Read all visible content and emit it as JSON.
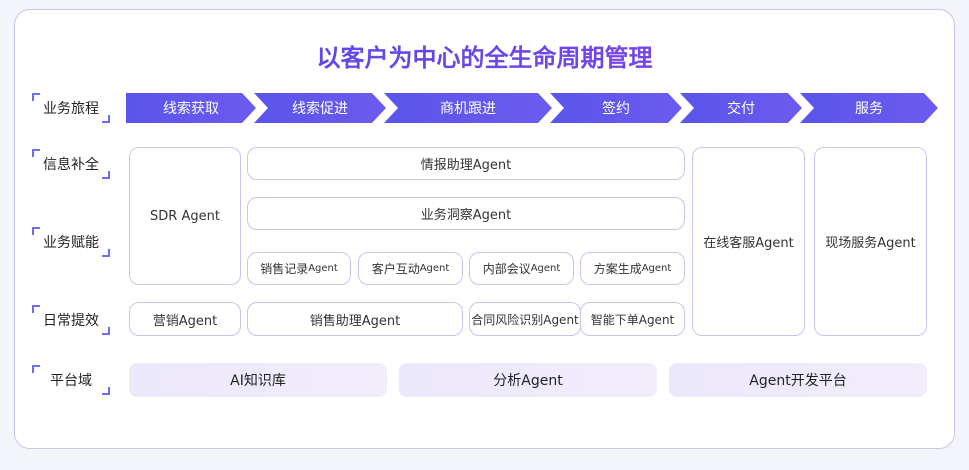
{
  "title": "以客户为中心的全生命周期管理",
  "row_labels": {
    "journey": "业务旅程",
    "info": "信息补全",
    "enable": "业务赋能",
    "daily": "日常提效",
    "platform": "平台域"
  },
  "journey_stages": [
    "线索获取",
    "线索促进",
    "商机跟进",
    "签约",
    "交付",
    "服务"
  ],
  "agents": {
    "sdr": "SDR Agent",
    "intel": "情报助理Agent",
    "insight": "业务洞察Agent",
    "sales_record": "销售记录",
    "customer_interact": "客户互动",
    "internal_meeting": "内部会议",
    "solution_gen": "方案生成",
    "agent_suffix": "Agent",
    "marketing": "营销Agent",
    "sales_assist": "销售助理Agent",
    "contract_risk": "合同风险识别Agent",
    "smart_order": "智能下单Agent",
    "online_cs": "在线客服Agent",
    "field_service": "现场服务Agent"
  },
  "platform": [
    "AI知识库",
    "分析Agent",
    "Agent开发平台"
  ],
  "colors": {
    "accent": "#5a55ea",
    "border": "#c9c3f0",
    "platform_bg": "#ece8fb"
  }
}
